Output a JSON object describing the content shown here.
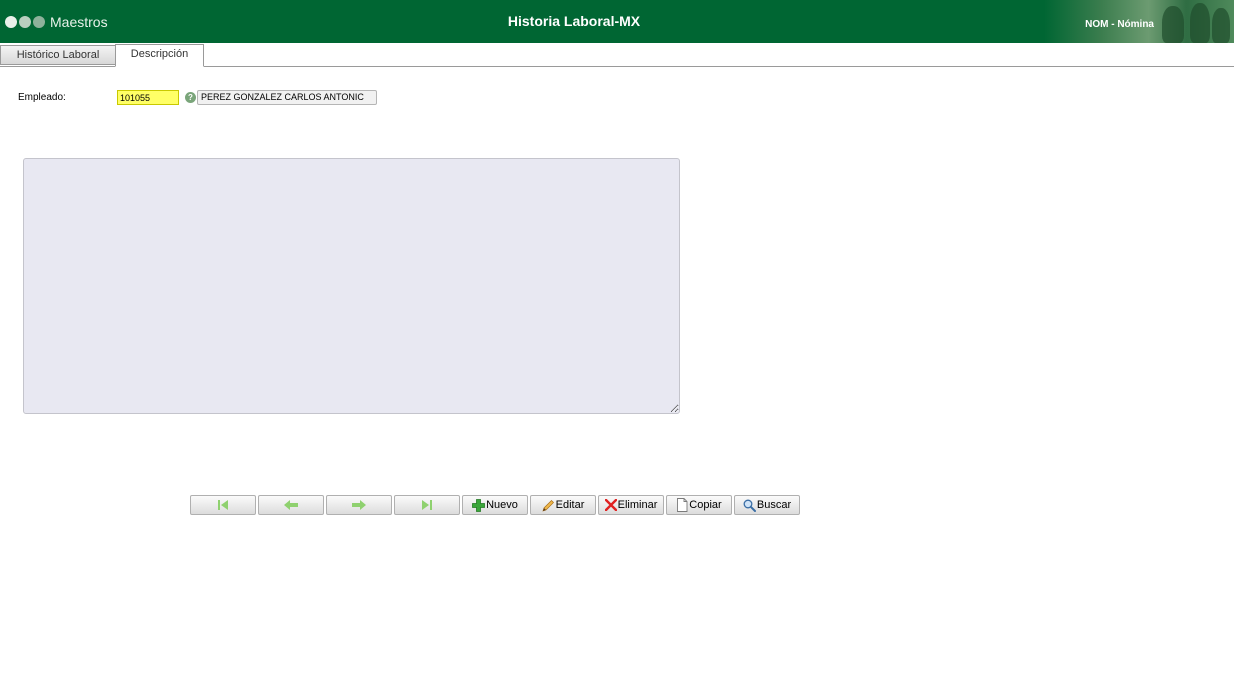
{
  "header": {
    "app_name": "Maestros",
    "page_title": "Historia Laboral-MX",
    "module_label": "NOM - Nómina"
  },
  "tabs": [
    {
      "label": "Histórico Laboral",
      "active": false
    },
    {
      "label": "Descripción",
      "active": true
    }
  ],
  "employee": {
    "label": "Empleado:",
    "code": "101055",
    "name": "PEREZ GONZALEZ CARLOS ANTONIC"
  },
  "description": {
    "value": ""
  },
  "toolbar": {
    "nav_buttons": [
      {
        "icon": "first-record-icon"
      },
      {
        "icon": "previous-record-icon"
      },
      {
        "icon": "next-record-icon"
      },
      {
        "icon": "last-record-icon"
      }
    ],
    "new_label": "Nuevo",
    "edit_label": "Editar",
    "delete_label": "Eliminar",
    "copy_label": "Copiar",
    "search_label": "Buscar"
  },
  "colors": {
    "header_green": "#006633",
    "code_field_yellow": "#ffff66",
    "textarea_bg": "#e8e8f2",
    "nav_arrow_green": "#8fd16f"
  }
}
